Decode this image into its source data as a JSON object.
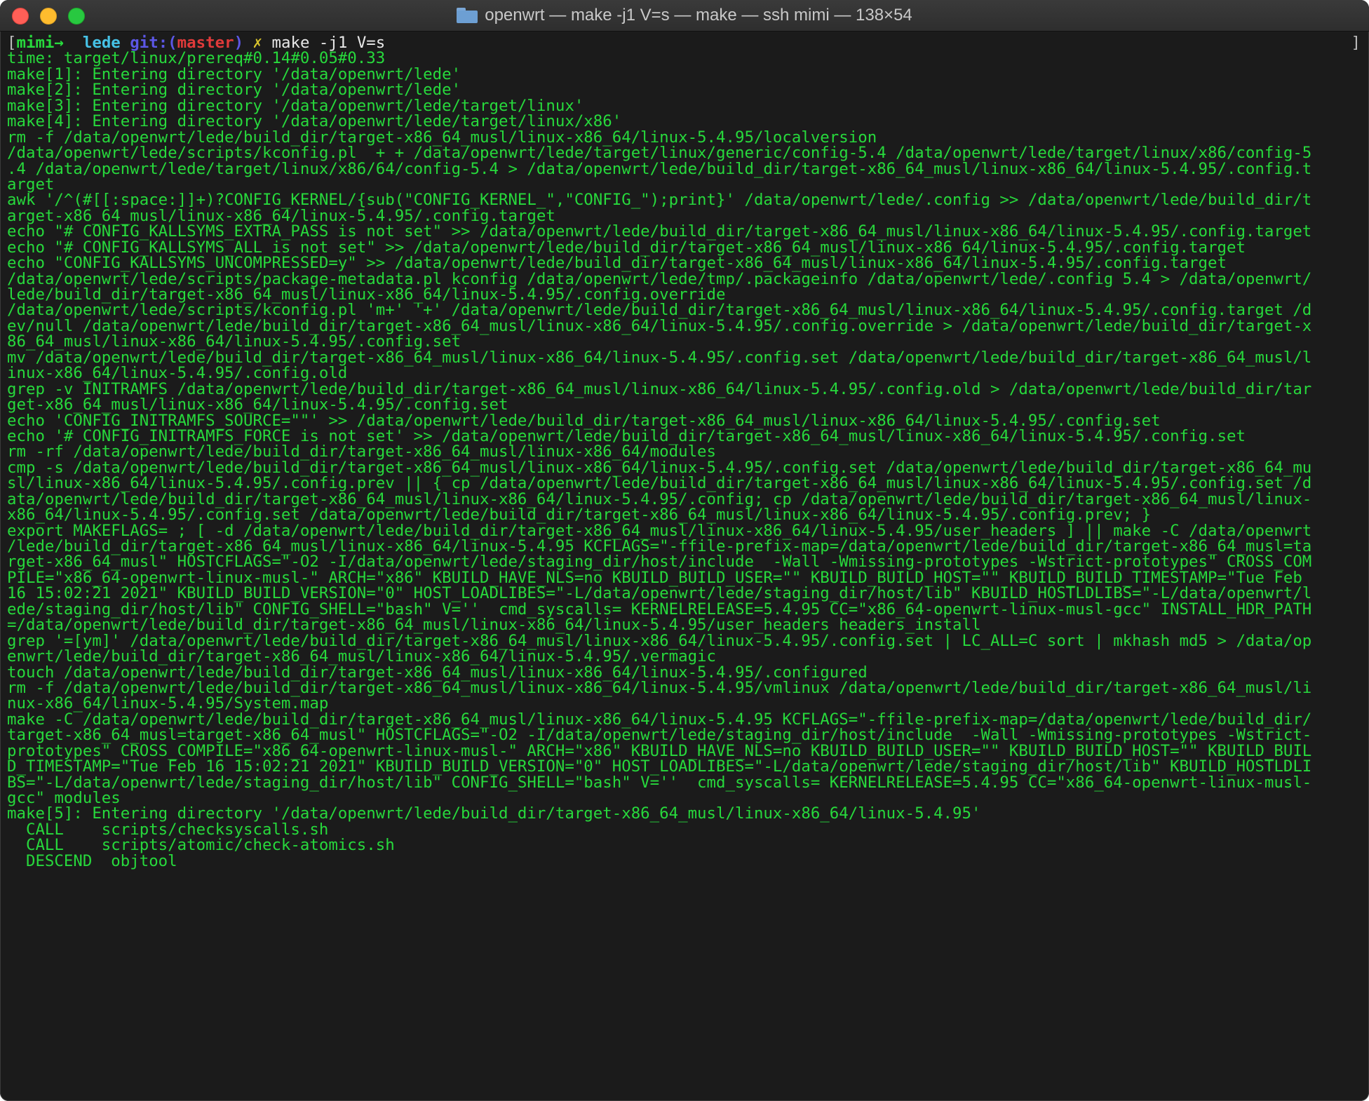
{
  "window": {
    "title": "openwrt — make -j1 V=s — make — ssh mimi — 138×54",
    "folder_icon": "folder-icon"
  },
  "prompt": {
    "open_bracket": "[",
    "user": "mimi",
    "arrow": "→",
    "dir": "lede",
    "git": "git:(",
    "branch": "master",
    "git_close": ")",
    "dirty": "✗",
    "command": "make -j1 V=s",
    "close_bracket": "]"
  },
  "output": [
    "time: target/linux/prereq#0.14#0.05#0.33",
    "make[1]: Entering directory '/data/openwrt/lede'",
    "make[2]: Entering directory '/data/openwrt/lede'",
    "make[3]: Entering directory '/data/openwrt/lede/target/linux'",
    "make[4]: Entering directory '/data/openwrt/lede/target/linux/x86'",
    "rm -f /data/openwrt/lede/build_dir/target-x86_64_musl/linux-x86_64/linux-5.4.95/localversion",
    "/data/openwrt/lede/scripts/kconfig.pl  + + /data/openwrt/lede/target/linux/generic/config-5.4 /data/openwrt/lede/target/linux/x86/config-5",
    ".4 /data/openwrt/lede/target/linux/x86/64/config-5.4 > /data/openwrt/lede/build_dir/target-x86_64_musl/linux-x86_64/linux-5.4.95/.config.t",
    "arget",
    "awk '/^(#[[:space:]]+)?CONFIG_KERNEL/{sub(\"CONFIG_KERNEL_\",\"CONFIG_\");print}' /data/openwrt/lede/.config >> /data/openwrt/lede/build_dir/t",
    "arget-x86_64_musl/linux-x86_64/linux-5.4.95/.config.target",
    "echo \"# CONFIG_KALLSYMS_EXTRA_PASS is not set\" >> /data/openwrt/lede/build_dir/target-x86_64_musl/linux-x86_64/linux-5.4.95/.config.target",
    "echo \"# CONFIG_KALLSYMS_ALL is not set\" >> /data/openwrt/lede/build_dir/target-x86_64_musl/linux-x86_64/linux-5.4.95/.config.target",
    "echo \"CONFIG_KALLSYMS_UNCOMPRESSED=y\" >> /data/openwrt/lede/build_dir/target-x86_64_musl/linux-x86_64/linux-5.4.95/.config.target",
    "/data/openwrt/lede/scripts/package-metadata.pl kconfig /data/openwrt/lede/tmp/.packageinfo /data/openwrt/lede/.config 5.4 > /data/openwrt/",
    "lede/build_dir/target-x86_64_musl/linux-x86_64/linux-5.4.95/.config.override",
    "/data/openwrt/lede/scripts/kconfig.pl 'm+' '+' /data/openwrt/lede/build_dir/target-x86_64_musl/linux-x86_64/linux-5.4.95/.config.target /d",
    "ev/null /data/openwrt/lede/build_dir/target-x86_64_musl/linux-x86_64/linux-5.4.95/.config.override > /data/openwrt/lede/build_dir/target-x",
    "86_64_musl/linux-x86_64/linux-5.4.95/.config.set",
    "mv /data/openwrt/lede/build_dir/target-x86_64_musl/linux-x86_64/linux-5.4.95/.config.set /data/openwrt/lede/build_dir/target-x86_64_musl/l",
    "inux-x86_64/linux-5.4.95/.config.old",
    "grep -v INITRAMFS /data/openwrt/lede/build_dir/target-x86_64_musl/linux-x86_64/linux-5.4.95/.config.old > /data/openwrt/lede/build_dir/tar",
    "get-x86_64_musl/linux-x86_64/linux-5.4.95/.config.set",
    "echo 'CONFIG_INITRAMFS_SOURCE=\"\"' >> /data/openwrt/lede/build_dir/target-x86_64_musl/linux-x86_64/linux-5.4.95/.config.set",
    "echo '# CONFIG_INITRAMFS_FORCE is not set' >> /data/openwrt/lede/build_dir/target-x86_64_musl/linux-x86_64/linux-5.4.95/.config.set",
    "rm -rf /data/openwrt/lede/build_dir/target-x86_64_musl/linux-x86_64/modules",
    "cmp -s /data/openwrt/lede/build_dir/target-x86_64_musl/linux-x86_64/linux-5.4.95/.config.set /data/openwrt/lede/build_dir/target-x86_64_mu",
    "sl/linux-x86_64/linux-5.4.95/.config.prev || { cp /data/openwrt/lede/build_dir/target-x86_64_musl/linux-x86_64/linux-5.4.95/.config.set /d",
    "ata/openwrt/lede/build_dir/target-x86_64_musl/linux-x86_64/linux-5.4.95/.config; cp /data/openwrt/lede/build_dir/target-x86_64_musl/linux-",
    "x86_64/linux-5.4.95/.config.set /data/openwrt/lede/build_dir/target-x86_64_musl/linux-x86_64/linux-5.4.95/.config.prev; }",
    "export MAKEFLAGS= ; [ -d /data/openwrt/lede/build_dir/target-x86_64_musl/linux-x86_64/linux-5.4.95/user_headers ] || make -C /data/openwrt",
    "/lede/build_dir/target-x86_64_musl/linux-x86_64/linux-5.4.95 KCFLAGS=\"-ffile-prefix-map=/data/openwrt/lede/build_dir/target-x86_64_musl=ta",
    "rget-x86_64_musl\" HOSTCFLAGS=\"-O2 -I/data/openwrt/lede/staging_dir/host/include  -Wall -Wmissing-prototypes -Wstrict-prototypes\" CROSS_COM",
    "PILE=\"x86_64-openwrt-linux-musl-\" ARCH=\"x86\" KBUILD_HAVE_NLS=no KBUILD_BUILD_USER=\"\" KBUILD_BUILD_HOST=\"\" KBUILD_BUILD_TIMESTAMP=\"Tue Feb",
    "16 15:02:21 2021\" KBUILD_BUILD_VERSION=\"0\" HOST_LOADLIBES=\"-L/data/openwrt/lede/staging_dir/host/lib\" KBUILD_HOSTLDLIBS=\"-L/data/openwrt/l",
    "ede/staging_dir/host/lib\" CONFIG_SHELL=\"bash\" V=''  cmd_syscalls= KERNELRELEASE=5.4.95 CC=\"x86_64-openwrt-linux-musl-gcc\" INSTALL_HDR_PATH",
    "=/data/openwrt/lede/build_dir/target-x86_64_musl/linux-x86_64/linux-5.4.95/user_headers headers_install",
    "grep '=[ym]' /data/openwrt/lede/build_dir/target-x86_64_musl/linux-x86_64/linux-5.4.95/.config.set | LC_ALL=C sort | mkhash md5 > /data/op",
    "enwrt/lede/build_dir/target-x86_64_musl/linux-x86_64/linux-5.4.95/.vermagic",
    "touch /data/openwrt/lede/build_dir/target-x86_64_musl/linux-x86_64/linux-5.4.95/.configured",
    "rm -f /data/openwrt/lede/build_dir/target-x86_64_musl/linux-x86_64/linux-5.4.95/vmlinux /data/openwrt/lede/build_dir/target-x86_64_musl/li",
    "nux-x86_64/linux-5.4.95/System.map",
    "make -C /data/openwrt/lede/build_dir/target-x86_64_musl/linux-x86_64/linux-5.4.95 KCFLAGS=\"-ffile-prefix-map=/data/openwrt/lede/build_dir/",
    "target-x86_64_musl=target-x86_64_musl\" HOSTCFLAGS=\"-O2 -I/data/openwrt/lede/staging_dir/host/include  -Wall -Wmissing-prototypes -Wstrict-",
    "prototypes\" CROSS_COMPILE=\"x86_64-openwrt-linux-musl-\" ARCH=\"x86\" KBUILD_HAVE_NLS=no KBUILD_BUILD_USER=\"\" KBUILD_BUILD_HOST=\"\" KBUILD_BUIL",
    "D_TIMESTAMP=\"Tue Feb 16 15:02:21 2021\" KBUILD_BUILD_VERSION=\"0\" HOST_LOADLIBES=\"-L/data/openwrt/lede/staging_dir/host/lib\" KBUILD_HOSTLDLI",
    "BS=\"-L/data/openwrt/lede/staging_dir/host/lib\" CONFIG_SHELL=\"bash\" V=''  cmd_syscalls= KERNELRELEASE=5.4.95 CC=\"x86_64-openwrt-linux-musl-",
    "gcc\" modules",
    "make[5]: Entering directory '/data/openwrt/lede/build_dir/target-x86_64_musl/linux-x86_64/linux-5.4.95'",
    "  CALL    scripts/checksyscalls.sh",
    "  CALL    scripts/atomic/check-atomics.sh",
    "  DESCEND  objtool"
  ]
}
